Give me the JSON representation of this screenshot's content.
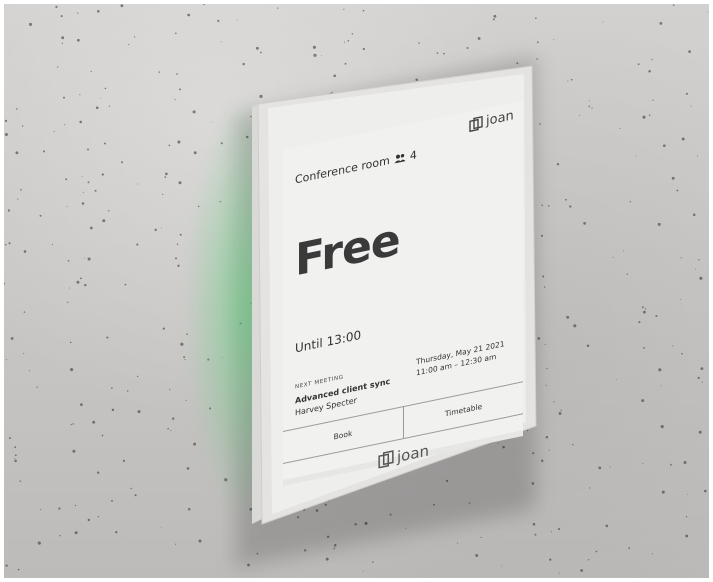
{
  "device": {
    "logo_top": "joan",
    "logo_bottom": "joan",
    "glow_color": "#5ad278"
  },
  "screen": {
    "room_name": "Conference room",
    "capacity": "4",
    "status": "Free",
    "until": "Until 13:00",
    "next_meeting": {
      "label": "NEXT MEETING",
      "title": "Advanced client sync",
      "host": "Harvey Specter",
      "date": "Thursday, May 21 2021",
      "time": "11:00 am – 12:30 am"
    },
    "buttons": {
      "book": "Book",
      "timetable": "Timetable"
    }
  }
}
